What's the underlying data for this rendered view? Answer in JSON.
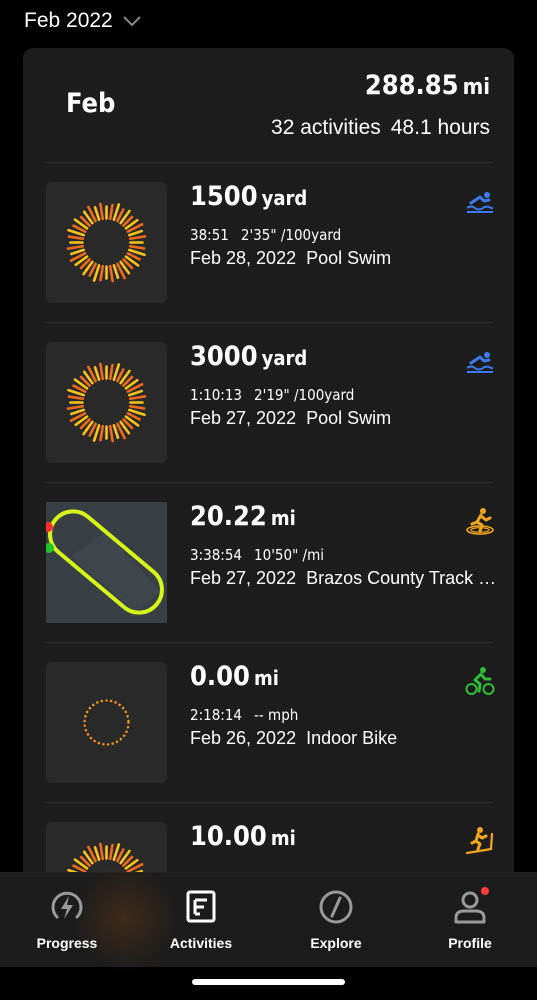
{
  "header": {
    "month_selector": "Feb 2022"
  },
  "summary": {
    "month": "Feb",
    "distance": "288.85",
    "distance_unit": "mi",
    "activities": "32 activities",
    "hours": "48.1 hours"
  },
  "activities": [
    {
      "distance": "1500",
      "unit": "yard",
      "duration": "38:51",
      "pace": "2'35\" /100yard",
      "date": "Feb 28, 2022",
      "name": "Pool Swim",
      "sport_icon": "swim-icon",
      "thumb": "swim-ring"
    },
    {
      "distance": "3000",
      "unit": "yard",
      "duration": "1:10:13",
      "pace": "2'19\" /100yard",
      "date": "Feb 27, 2022",
      "name": "Pool Swim",
      "sport_icon": "swim-icon",
      "thumb": "swim-ring"
    },
    {
      "distance": "20.22",
      "unit": "mi",
      "duration": "3:38:54",
      "pace": "10'50\" /mi",
      "date": "Feb 27, 2022",
      "name": "Brazos County Track Running",
      "sport_icon": "track-run-icon",
      "thumb": "track-map"
    },
    {
      "distance": "0.00",
      "unit": "mi",
      "duration": "2:18:14",
      "pace": "-- mph",
      "date": "Feb 26, 2022",
      "name": "Indoor Bike",
      "sport_icon": "bike-icon",
      "thumb": "dotted-ring"
    },
    {
      "distance": "10.00",
      "unit": "mi",
      "sport_icon": "treadmill-icon",
      "thumb": "swim-ring"
    }
  ],
  "nav": {
    "progress": "Progress",
    "activities": "Activities",
    "explore": "Explore",
    "profile": "Profile"
  },
  "colors": {
    "swim": "#3d7cf0",
    "run": "#f2a61f",
    "bike": "#2fbd3a",
    "track": "#d8f51a",
    "notification": "#ff3b3b"
  }
}
